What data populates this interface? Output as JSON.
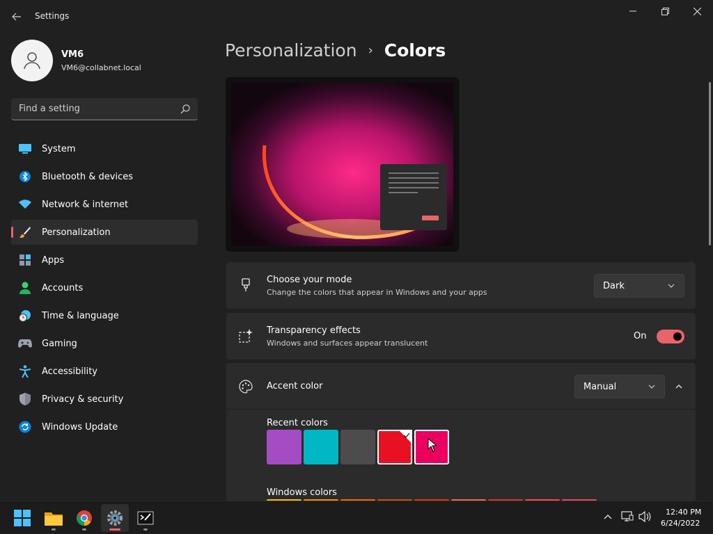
{
  "window": {
    "title": "Settings"
  },
  "user": {
    "name": "VM6",
    "email": "VM6@collabnet.local"
  },
  "search": {
    "placeholder": "Find a setting"
  },
  "sidebar": {
    "items": [
      {
        "label": "System",
        "icon": "monitor-icon"
      },
      {
        "label": "Bluetooth & devices",
        "icon": "bluetooth-icon"
      },
      {
        "label": "Network & internet",
        "icon": "wifi-icon"
      },
      {
        "label": "Personalization",
        "icon": "brush-icon",
        "active": true
      },
      {
        "label": "Apps",
        "icon": "apps-icon"
      },
      {
        "label": "Accounts",
        "icon": "person-icon"
      },
      {
        "label": "Time & language",
        "icon": "clock-globe-icon"
      },
      {
        "label": "Gaming",
        "icon": "gamepad-icon"
      },
      {
        "label": "Accessibility",
        "icon": "accessibility-icon"
      },
      {
        "label": "Privacy & security",
        "icon": "shield-icon"
      },
      {
        "label": "Windows Update",
        "icon": "update-icon"
      }
    ]
  },
  "breadcrumb": {
    "parent": "Personalization",
    "separator": "›",
    "current": "Colors"
  },
  "mode": {
    "title": "Choose your mode",
    "description": "Change the colors that appear in Windows and your apps",
    "value": "Dark"
  },
  "transparency": {
    "title": "Transparency effects",
    "description": "Windows and surfaces appear translucent",
    "state_label": "On",
    "enabled": true
  },
  "accent": {
    "title": "Accent color",
    "value": "Manual",
    "expanded": true
  },
  "recent_colors": {
    "title": "Recent colors",
    "colors": [
      "#a54cc4",
      "#00b7c3",
      "#4c4c4c",
      "#e81123",
      "#ea005e"
    ],
    "selected_index": 3
  },
  "windows_colors": {
    "title": "Windows colors",
    "colors": [
      "#ffb900",
      "#ff8c00",
      "#f7630c",
      "#ca5010",
      "#da3b01",
      "#ef6950",
      "#d13438",
      "#ff4343",
      "#e74856"
    ]
  },
  "taskbar": {
    "apps": [
      {
        "name": "start-icon"
      },
      {
        "name": "file-explorer-icon"
      },
      {
        "name": "chrome-icon"
      },
      {
        "name": "settings-app-icon",
        "active": true
      },
      {
        "name": "terminal-app-icon"
      }
    ]
  },
  "clock": {
    "time": "12:40 PM",
    "date": "6/24/2022"
  },
  "colors": {
    "accent": "#e8646a",
    "background": "#202020",
    "card": "#2b2b2b"
  }
}
